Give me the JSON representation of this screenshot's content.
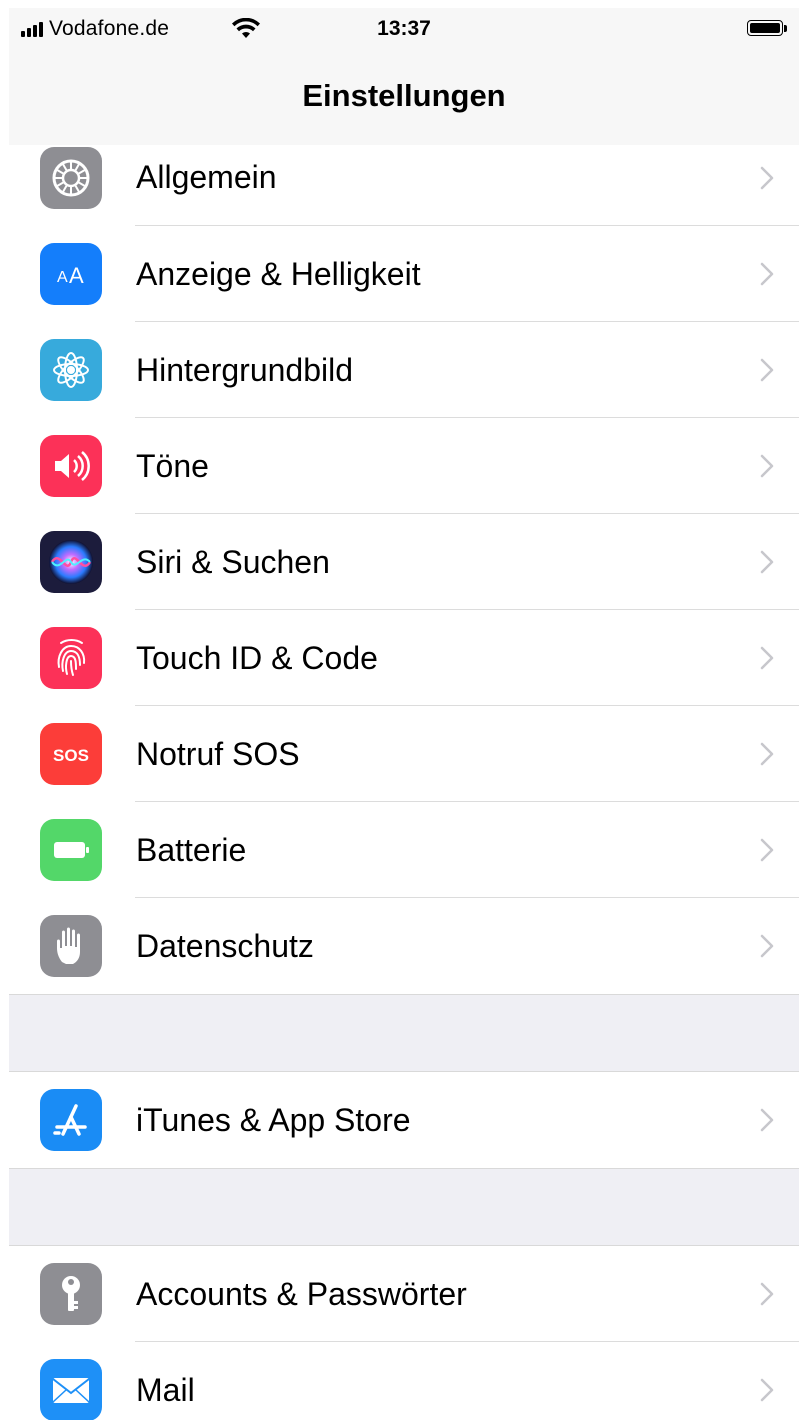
{
  "status_bar": {
    "carrier": "Vodafone.de",
    "time": "13:37",
    "battery_level": 1.0
  },
  "navigation": {
    "title": "Einstellungen"
  },
  "groups": [
    {
      "items": [
        {
          "label": "Allgemein",
          "icon": "gear-icon",
          "color": "#8e8e93"
        },
        {
          "label": "Anzeige & Helligkeit",
          "icon": "text-size-icon",
          "color": "#147efb"
        },
        {
          "label": "Hintergrundbild",
          "icon": "flower-icon",
          "color": "#37aadc"
        },
        {
          "label": "Töne",
          "icon": "speaker-icon",
          "color": "#fc3158"
        },
        {
          "label": "Siri & Suchen",
          "icon": "siri-icon",
          "color": "#1c1c3c"
        },
        {
          "label": "Touch ID & Code",
          "icon": "fingerprint-icon",
          "color": "#fc3158"
        },
        {
          "label": "Notruf SOS",
          "icon": "sos-icon",
          "color": "#fc3d39",
          "icon_text": "SOS"
        },
        {
          "label": "Batterie",
          "icon": "battery-icon",
          "color": "#53d769"
        },
        {
          "label": "Datenschutz",
          "icon": "hand-icon",
          "color": "#8e8e93"
        }
      ]
    },
    {
      "items": [
        {
          "label": "iTunes & App Store",
          "icon": "app-store-icon",
          "color": "#1a8cf5"
        }
      ]
    },
    {
      "items": [
        {
          "label": "Accounts & Passwörter",
          "icon": "key-icon",
          "color": "#8e8e93"
        },
        {
          "label": "Mail",
          "icon": "mail-icon",
          "color": "#1e90f7"
        }
      ]
    }
  ]
}
